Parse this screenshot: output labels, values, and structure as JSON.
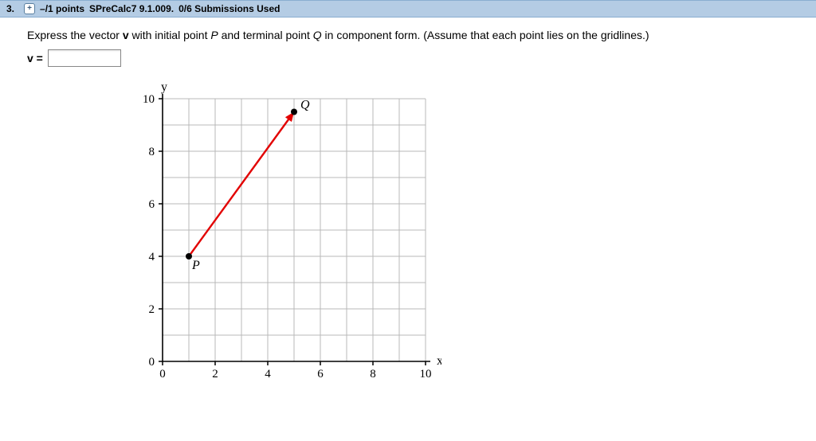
{
  "header": {
    "question_number": "3.",
    "expand": "+",
    "points": "–/1 points",
    "assignment": "SPreCalc7 9.1.009.",
    "submissions": "0/6 Submissions Used"
  },
  "prompt": {
    "pre": "Express the vector ",
    "vec": "v",
    "mid1": " with initial point ",
    "P": "P",
    "mid2": " and terminal point ",
    "Q": "Q",
    "post": " in component form. (Assume that each point lies on the gridlines.)"
  },
  "answer": {
    "label": "v =",
    "value": ""
  },
  "chart_data": {
    "type": "scatter",
    "title": "",
    "xlabel": "x",
    "ylabel": "y",
    "xlim": [
      0,
      10
    ],
    "ylim": [
      0,
      10
    ],
    "x_ticks": [
      0,
      2,
      4,
      6,
      8,
      10
    ],
    "y_ticks": [
      0,
      2,
      4,
      6,
      8,
      10
    ],
    "grid": true,
    "points": [
      {
        "name": "P",
        "x": 1,
        "y": 4
      },
      {
        "name": "Q",
        "x": 5,
        "y": 9.5
      }
    ],
    "vector": {
      "from": "P",
      "to": "Q",
      "color": "#e20000"
    }
  }
}
